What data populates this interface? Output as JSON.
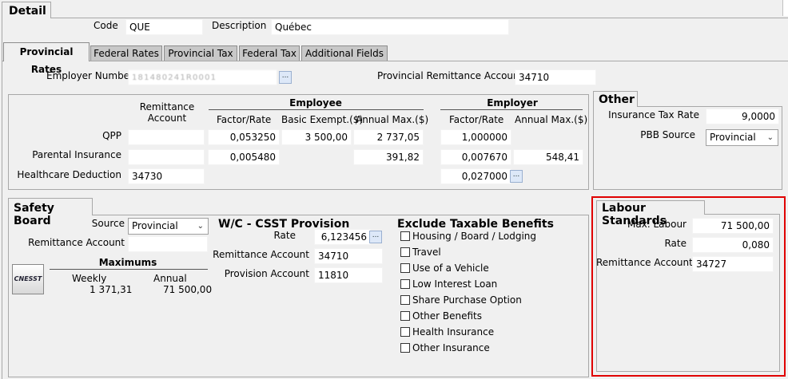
{
  "window": {
    "section_title": "Detail"
  },
  "header": {
    "code_label": "Code",
    "code_value": "QUE",
    "description_label": "Description",
    "description_value": "Québec"
  },
  "tabs": [
    {
      "label": "Provincial Rates",
      "active": true
    },
    {
      "label": "Federal Rates"
    },
    {
      "label": "Provincial Tax"
    },
    {
      "label": "Federal Tax"
    },
    {
      "label": "Additional Fields"
    }
  ],
  "employer": {
    "employer_number_label": "Employer Number",
    "employer_number_value": "1 8 1 4 8 0 2 4 1 R 0 0 0 1",
    "remittance_account_label": "Provincial Remittance Account",
    "remittance_account_value": "34710"
  },
  "rates": {
    "remittance_header": "Remittance Account",
    "employee_header": "Employee",
    "employer_header": "Employer",
    "col_factor_rate": "Factor/Rate",
    "col_basic_exempt": "Basic Exempt.($)",
    "col_annual_max": "Annual Max.($)",
    "col_er_factor_rate": "Factor/Rate",
    "col_er_annual_max": "Annual Max.($)",
    "rows": [
      {
        "label": "QPP",
        "remittance": "",
        "ee_rate": "0,053250",
        "ee_exempt": "3 500,00",
        "ee_max": "2 737,05",
        "er_rate": "1,000000",
        "er_max": ""
      },
      {
        "label": "Parental Insurance",
        "remittance": "",
        "ee_rate": "0,005480",
        "ee_exempt": "",
        "ee_max": "391,82",
        "er_rate": "0,007670",
        "er_max": "548,41"
      },
      {
        "label": "Healthcare Deduction",
        "remittance": "34730",
        "er_rate": "0,027000"
      }
    ]
  },
  "other": {
    "title": "Other",
    "insurance_tax_rate_label": "Insurance Tax Rate",
    "insurance_tax_rate_value": "9,0000",
    "pbb_source_label": "PBB Source",
    "pbb_source_value": "Provincial"
  },
  "safety_board": {
    "title": "Safety Board",
    "source_label": "Source",
    "source_value": "Provincial",
    "remittance_label": "Remittance Account",
    "remittance_value": "",
    "logo_text": "CNESST",
    "maximums_label": "Maximums",
    "weekly_label": "Weekly",
    "weekly_value": "1 371,31",
    "annual_label": "Annual",
    "annual_value": "71 500,00"
  },
  "wc_provision": {
    "title": "W/C - CSST Provision",
    "rate_label": "Rate",
    "rate_value": "6,123456",
    "remittance_label": "Remittance Account",
    "remittance_value": "34710",
    "provision_label": "Provision Account",
    "provision_value": "11810"
  },
  "exclude_benefits": {
    "title": "Exclude Taxable Benefits",
    "items": [
      "Housing / Board / Lodging",
      "Travel",
      "Use of a Vehicle",
      "Low Interest Loan",
      "Share Purchase Option",
      "Other Benefits",
      "Health Insurance",
      "Other Insurance"
    ]
  },
  "labour_standards": {
    "title": "Labour Standards",
    "max_labour_label": "Max. Labour",
    "max_labour_value": "71 500,00",
    "rate_label": "Rate",
    "rate_value": "0,080",
    "remittance_label": "Remittance Account",
    "remittance_value": "34727",
    "highlight_color": "#e00000"
  },
  "ellipsis": "..."
}
